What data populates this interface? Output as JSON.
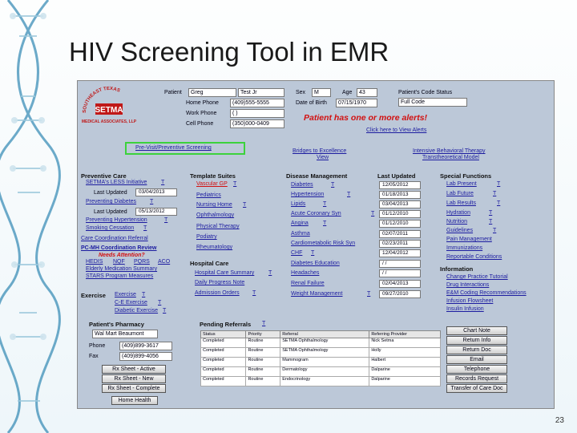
{
  "slide": {
    "title": "HIV Screening Tool in EMR",
    "page_number": "23"
  },
  "patient": {
    "label": "Patient",
    "first": "Greg",
    "last": "Test Jr",
    "home_label": "Home Phone",
    "home": "(409)555-5555",
    "work_label": "Work Phone",
    "work": "( )",
    "cell_label": "Cell Phone",
    "cell": "(350)000-0409",
    "sex_label": "Sex",
    "sex": "M",
    "age_label": "Age",
    "age": "43",
    "dob_label": "Date of Birth",
    "dob": "07/15/1970",
    "code_label": "Patient's Code Status",
    "code": "Full Code",
    "alert": "Patient has one or more alerts!",
    "alert_link": "Click here to View Alerts"
  },
  "logo": {
    "text": "SOUTHEAST TEXAS MEDICAL ASSOCIATES, LLP",
    "mark": "SETMA"
  },
  "links": {
    "previsit": "Pre-Visit/Preventive Screening",
    "bridges": "Bridges to Excellence",
    "bridges_view": "View",
    "ibt": "Intensive Behavioral Therapy",
    "ibt_sub": "Transtheoretical Model"
  },
  "preventive": {
    "title": "Preventive Care",
    "items": [
      {
        "label": "SETMA's LESS Initiative",
        "t": "T"
      },
      {
        "label": "Last Updated",
        "date": "03/04/2013"
      },
      {
        "label": "Preventing Diabetes",
        "t": "T"
      },
      {
        "label": "Last Updated",
        "date": "05/13/2012"
      },
      {
        "label": "Preventing Hypertension",
        "t": "T"
      },
      {
        "label": "Smoking Cessation",
        "t": "T"
      }
    ],
    "care_coord": "Care Coordination Referral",
    "pc_mh": "PC-MH Coordination Review",
    "needs": "Needs Attention?",
    "needs_items": [
      "HEDIS",
      "NQF",
      "PQRS",
      "ACO"
    ],
    "elderly": "Elderly Medication Summary",
    "stars": "STARS Program Measures"
  },
  "template": {
    "title": "Template Suites",
    "items": [
      {
        "label": "Vascular GP",
        "t": "T"
      },
      {
        "label": "Pediatrics"
      },
      {
        "label": "Nursing Home",
        "t": "T"
      },
      {
        "label": "Ophthalmology"
      },
      {
        "label": "Physical Therapy"
      },
      {
        "label": "Podiatry"
      },
      {
        "label": "Rheumatology"
      }
    ],
    "hospital_title": "Hospital Care",
    "hospital": [
      {
        "label": "Hospital Care Summary",
        "t": "T"
      },
      {
        "label": "Daily Progress Note"
      },
      {
        "label": "Admission Orders",
        "t": "T"
      }
    ]
  },
  "disease": {
    "title": "Disease Management",
    "last_updated": "Last Updated",
    "items": [
      {
        "label": "Diabetes",
        "t": "T",
        "date": "12/05/2012"
      },
      {
        "label": "Hypertension",
        "t": "T",
        "date": "01/18/2013"
      },
      {
        "label": "Lipids",
        "t": "T",
        "date": "03/04/2013"
      },
      {
        "label": "Acute Coronary Syn",
        "t": "T",
        "date": "01/12/2010"
      },
      {
        "label": "Angina",
        "t": "T",
        "date": "01/12/2010"
      },
      {
        "label": "Asthma",
        "date": "02/07/2011"
      },
      {
        "label": "Cardiometabolic Risk Syn",
        "t": "T",
        "date": "02/23/2011"
      },
      {
        "label": "CHF",
        "t": "T",
        "date": "12/04/2012"
      },
      {
        "label": "Diabetes Education",
        "date": "/ /"
      },
      {
        "label": "Headaches",
        "date": "/ /"
      },
      {
        "label": "Renal Failure",
        "date": "02/04/2013"
      },
      {
        "label": "Weight Management",
        "t": "T",
        "date": "09/27/2010"
      }
    ]
  },
  "special": {
    "title": "Special Functions",
    "items": [
      {
        "label": "Lab Present",
        "t": "T"
      },
      {
        "label": "Lab Future",
        "t": "T"
      },
      {
        "label": "Lab Results",
        "t": "T"
      },
      {
        "label": "Hydration",
        "t": "T"
      },
      {
        "label": "Nutrition",
        "t": "T"
      },
      {
        "label": "Guidelines",
        "t": "T"
      },
      {
        "label": "Pain Management"
      },
      {
        "label": "Immunizations"
      },
      {
        "label": "Reportable Conditions"
      }
    ],
    "info_title": "Information",
    "info": [
      "Change Practice Tutorial",
      "Drug Interactions",
      "E&M Coding Recommendations",
      "Infusion Flowsheet",
      "Insulin Infusion"
    ]
  },
  "exercise": {
    "label": "Exercise",
    "items": [
      {
        "label": "Exercise",
        "t": "T"
      },
      {
        "label": "C-E Exercise",
        "t": "T"
      },
      {
        "label": "Diabetic Exercise",
        "t": "T"
      }
    ]
  },
  "pharmacy": {
    "title": "Patient's Pharmacy",
    "name": "Wal Mart",
    "city": "Beaumont",
    "phone_label": "Phone",
    "phone": "(409)899-3617",
    "fax_label": "Fax",
    "fax": "(409)899-4056",
    "buttons": [
      "Rx Sheet - Active",
      "Rx Sheet - New",
      "Rx Sheet - Complete",
      "Home Health"
    ]
  },
  "referrals": {
    "title": "Pending Referrals",
    "t": "T",
    "columns": [
      "Status",
      "Priority",
      "Referral",
      "Referring Provider"
    ],
    "rows": [
      [
        "Completed",
        "Routine",
        "SETMA Ophthalmology",
        "Nick Setma"
      ],
      [
        "Completed",
        "Routine",
        "SETMA Ophthalmology",
        "Holly"
      ],
      [
        "Completed",
        "Routine",
        "Mammogram",
        "Halbert"
      ],
      [
        "Completed",
        "Routine",
        "Dermatology",
        "Dalparine"
      ],
      [
        "Completed",
        "Routine",
        "Endocrinology",
        "Dalparine"
      ]
    ]
  },
  "actions": [
    "Chart Note",
    "Return Info",
    "Return Doc",
    "Email",
    "Telephone",
    "Records Request",
    "Transfer of Care Doc"
  ]
}
